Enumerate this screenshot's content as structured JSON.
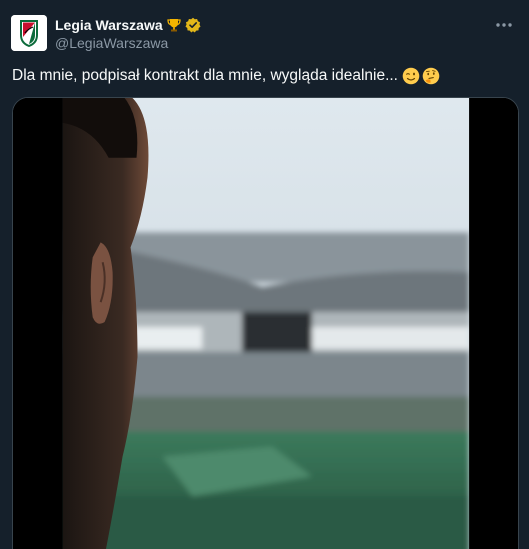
{
  "author": {
    "display_name": "Legia Warszawa",
    "handle": "@LegiaWarszawa",
    "badge_icon": "trophy-icon",
    "verified_icon": "verified-badge-icon",
    "verified_color": "#e2b719",
    "logo_icon": "legia-crest-logo"
  },
  "tweet": {
    "text": "Dla mnie, podpisał kontrakt dla mnie, wygląda idealnie...",
    "emojis": [
      "winking-face-emoji",
      "thinking-face-emoji"
    ]
  },
  "media": {
    "type": "video",
    "description_icon": "video-player"
  },
  "menu": {
    "icon": "more-options-icon"
  },
  "colors": {
    "background": "#15202b",
    "text_primary": "#f7f9f9",
    "text_secondary": "#8b98a5",
    "border": "#38444d"
  }
}
